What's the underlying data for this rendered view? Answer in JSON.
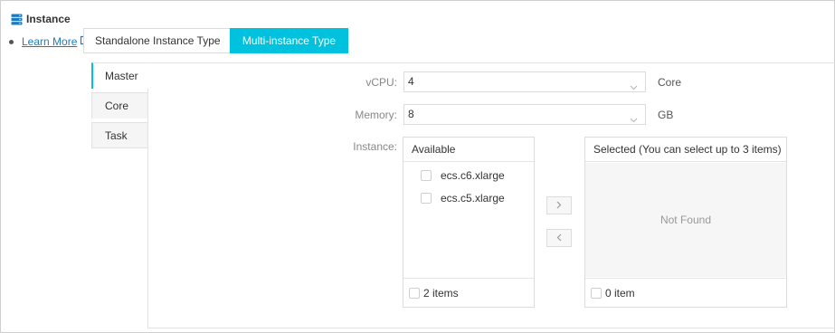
{
  "section": {
    "title": "Instance",
    "icon": "server-stack-icon"
  },
  "learn_more": {
    "label": "Learn More",
    "icon": "external-link-icon"
  },
  "type_tabs": [
    {
      "label": "Standalone Instance Type",
      "active": false
    },
    {
      "label": "Multi-instance Type",
      "active": true
    }
  ],
  "role_tabs": [
    {
      "label": "Master",
      "active": true
    },
    {
      "label": "Core",
      "active": false
    },
    {
      "label": "Task",
      "active": false
    }
  ],
  "form": {
    "vcpu": {
      "label": "vCPU:",
      "value": "4",
      "unit": "Core"
    },
    "memory": {
      "label": "Memory:",
      "value": "8",
      "unit": "GB"
    },
    "instance_label": "Instance:"
  },
  "transfer": {
    "available": {
      "title": "Available",
      "items": [
        "ecs.c6.xlarge",
        "ecs.c5.xlarge"
      ],
      "footer": "2 items"
    },
    "selected": {
      "title": "Selected (You can select up to 3 items)",
      "empty_text": "Not Found",
      "footer": "0 item"
    }
  },
  "colors": {
    "accent": "#00c1de",
    "link": "#1f7bbf"
  }
}
